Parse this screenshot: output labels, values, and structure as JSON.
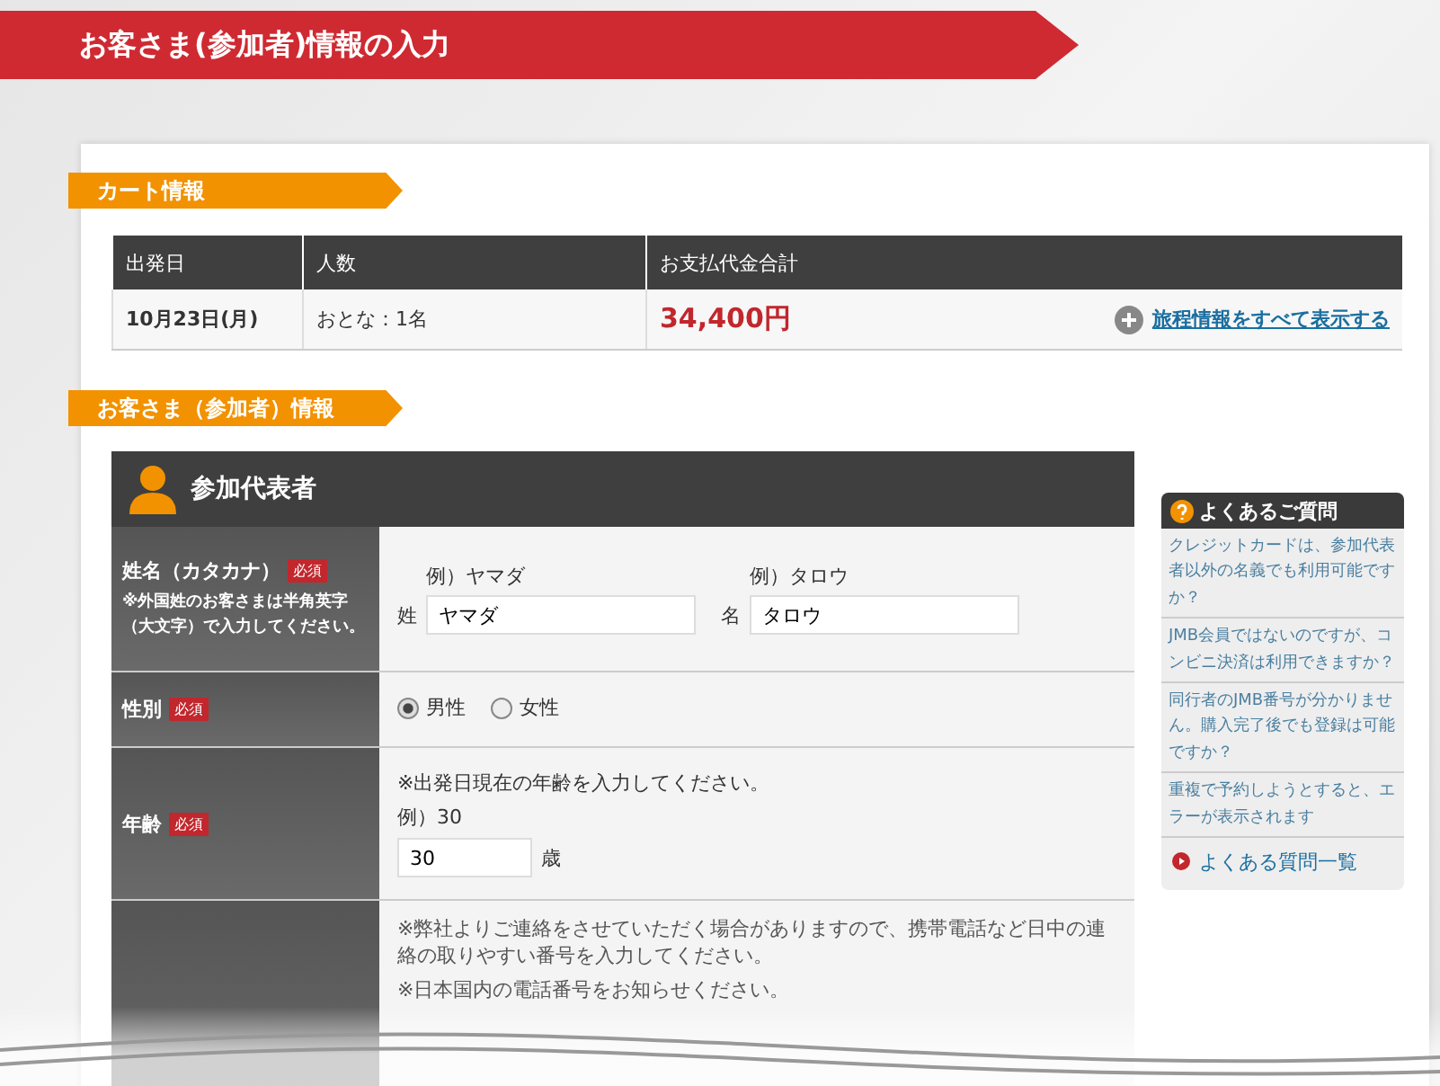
{
  "page_title": "お客さま(参加者)情報の入力",
  "cart": {
    "heading": "カート情報",
    "columns": [
      "出発日",
      "人数",
      "お支払代金合計"
    ],
    "row": {
      "date": "10月23日(月)",
      "people": "おとな：1名",
      "total": "34,400円"
    },
    "show_all_link": "旅程情報をすべて表示する"
  },
  "customer": {
    "heading": "お客さま（参加者）情報",
    "section_title": "参加代表者",
    "name_row": {
      "label": "姓名（カタカナ）",
      "required": "必須",
      "note": "※外国姓のお客さまは半角英字（大文字）で入力してください。",
      "fields": [
        {
          "prefix": "姓",
          "example": "例）ヤマダ",
          "value": "ヤマダ"
        },
        {
          "prefix": "名",
          "example": "例）タロウ",
          "value": "タロウ"
        }
      ]
    },
    "gender_row": {
      "label": "性別",
      "required": "必須",
      "options": [
        {
          "label": "男性",
          "selected": true
        },
        {
          "label": "女性",
          "selected": false
        }
      ]
    },
    "age_row": {
      "label": "年齢",
      "required": "必須",
      "note": "※出発日現在の年齢を入力してください。",
      "example": "例）30",
      "value": "30",
      "unit": "歳"
    },
    "phone_row": {
      "notes": [
        "※弊社よりご連絡をさせていただく場合がありますので、携帯電話など日中の連絡の取りやすい番号を入力してください。",
        "※日本国内の電話番号をお知らせください。"
      ]
    }
  },
  "faq": {
    "title": "よくあるご質問",
    "items": [
      "クレジットカードは、参加代表者以外の名義でも利用可能ですか？",
      "JMB会員ではないのですが、コンビニ決済は利用できますか？",
      "同行者のJMB番号が分かりません。購入完了後でも登録は可能ですか？",
      "重複で予約しようとすると、エラーが表示されます"
    ],
    "more_link": "よくある質問一覧"
  }
}
